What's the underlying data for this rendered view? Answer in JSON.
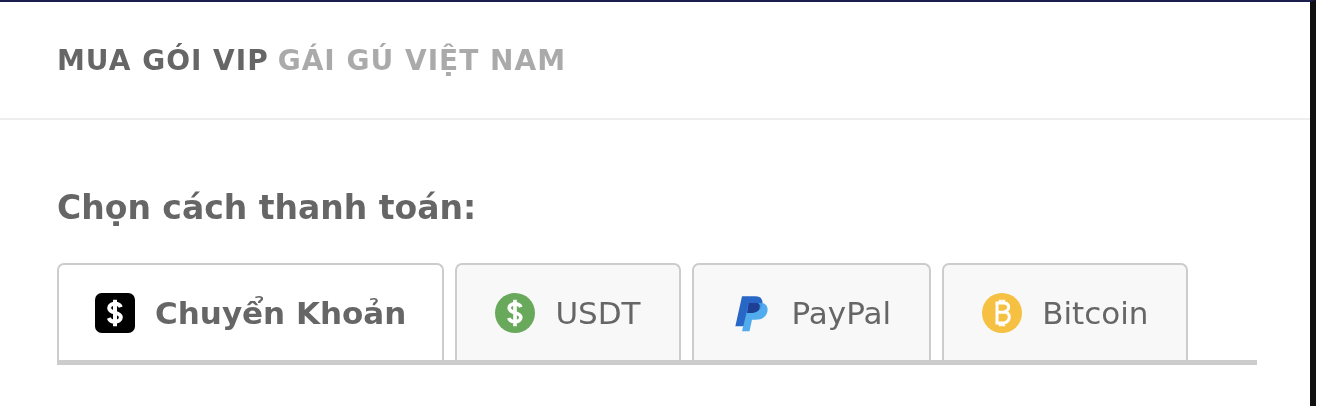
{
  "header": {
    "title_main": "MUA GÓI VIP",
    "title_sub": "GÁI GÚ VIỆT NAM"
  },
  "prompt": "Chọn cách thanh toán:",
  "tabs": [
    {
      "label": "Chuyển Khoản",
      "kind": "cash",
      "selected": true
    },
    {
      "label": "USDT",
      "kind": "usdt",
      "selected": false
    },
    {
      "label": "PayPal",
      "kind": "paypal",
      "selected": false
    },
    {
      "label": "Bitcoin",
      "kind": "bitcoin",
      "selected": false
    }
  ]
}
